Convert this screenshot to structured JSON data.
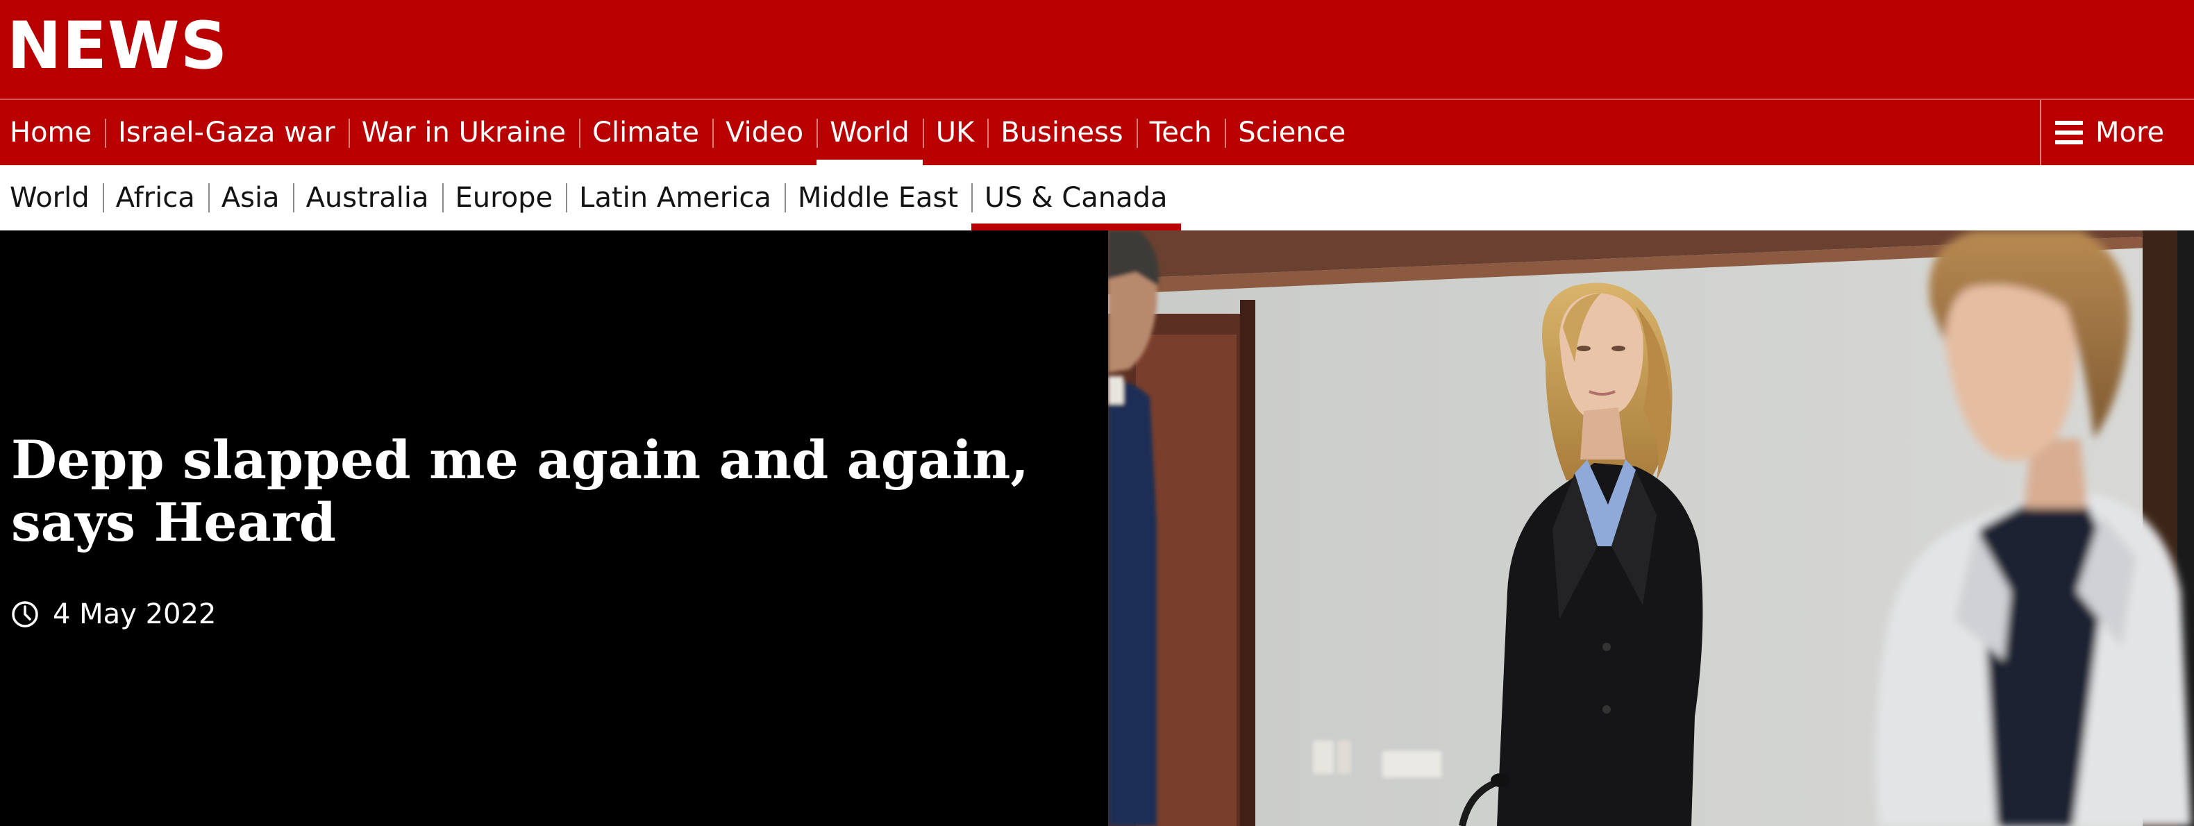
{
  "brand": {
    "name": "NEWS"
  },
  "primary_nav": {
    "items": [
      {
        "label": "Home"
      },
      {
        "label": "Israel-Gaza war"
      },
      {
        "label": "War in Ukraine"
      },
      {
        "label": "Climate"
      },
      {
        "label": "Video"
      },
      {
        "label": "World"
      },
      {
        "label": "UK"
      },
      {
        "label": "Business"
      },
      {
        "label": "Tech"
      },
      {
        "label": "Science"
      }
    ],
    "active": "World",
    "more_label": "More"
  },
  "secondary_nav": {
    "items": [
      {
        "label": "World"
      },
      {
        "label": "Africa"
      },
      {
        "label": "Asia"
      },
      {
        "label": "Australia"
      },
      {
        "label": "Europe"
      },
      {
        "label": "Latin America"
      },
      {
        "label": "Middle East"
      },
      {
        "label": "US & Canada"
      }
    ],
    "active": "US & Canada"
  },
  "article": {
    "headline": "Depp slapped me again and again, says Heard",
    "date": "4 May 2022",
    "date_icon": "clock-icon"
  },
  "colors": {
    "brand_red": "#b80000",
    "white": "#ffffff",
    "hero_background": "#000000",
    "secondary_text": "#141414"
  }
}
